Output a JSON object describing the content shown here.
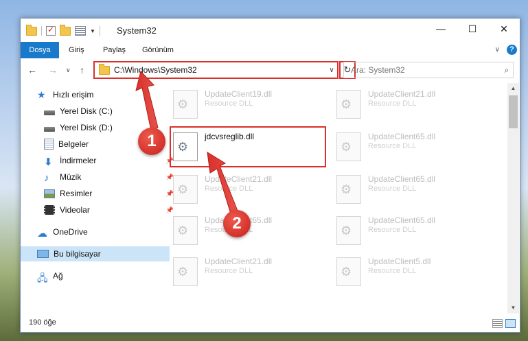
{
  "window": {
    "title": "System32",
    "controls": {
      "minimize": "—",
      "maximize": "☐",
      "close": "✕"
    }
  },
  "ribbon": {
    "tabs": [
      "Dosya",
      "Giriş",
      "Paylaş",
      "Görünüm"
    ],
    "help": "?"
  },
  "nav": {
    "address": "C:\\Windows\\System32",
    "search_placeholder": "Ara: System32"
  },
  "sidebar": {
    "items": [
      {
        "label": "Hızlı erişim",
        "icon": "star-icon"
      },
      {
        "label": "Yerel Disk (C:)",
        "icon": "disk-icon"
      },
      {
        "label": "Yerel Disk (D:)",
        "icon": "disk-icon"
      },
      {
        "label": "Belgeler",
        "icon": "documents-icon"
      },
      {
        "label": "İndirmeler",
        "icon": "download-icon"
      },
      {
        "label": "Müzik",
        "icon": "music-icon"
      },
      {
        "label": "Resimler",
        "icon": "pictures-icon"
      },
      {
        "label": "Videolar",
        "icon": "videos-icon"
      },
      {
        "label": "OneDrive",
        "icon": "cloud-icon"
      },
      {
        "label": "Bu bilgisayar",
        "icon": "computer-icon"
      },
      {
        "label": "Ağ",
        "icon": "network-icon"
      }
    ]
  },
  "files": [
    {
      "name": "UpdateClient19.dll",
      "type": "Resource DLL"
    },
    {
      "name": "UpdateClient21.dll",
      "type": "Resource DLL"
    },
    {
      "name": "jdcvsreglib.dll",
      "type": ""
    },
    {
      "name": "UpdateClient65.dll",
      "type": "Resource DLL"
    },
    {
      "name": "UpdateClient21.dll",
      "type": "Resource DLL"
    },
    {
      "name": "UpdateClient65.dll",
      "type": "Resource DLL"
    },
    {
      "name": "UpdateClient65.dll",
      "type": "Resource DLL"
    },
    {
      "name": "UpdateClient65.dll",
      "type": "Resource DLL"
    },
    {
      "name": "UpdateClient21.dll",
      "type": "Resource DLL"
    },
    {
      "name": "UpdateClient5.dll",
      "type": "Resource DLL"
    }
  ],
  "status": {
    "count": "190 öğe"
  },
  "callouts": [
    "1",
    "2"
  ],
  "colors": {
    "accent": "#1979ca",
    "highlight": "#d9302c",
    "selected": "#cce4f7"
  }
}
